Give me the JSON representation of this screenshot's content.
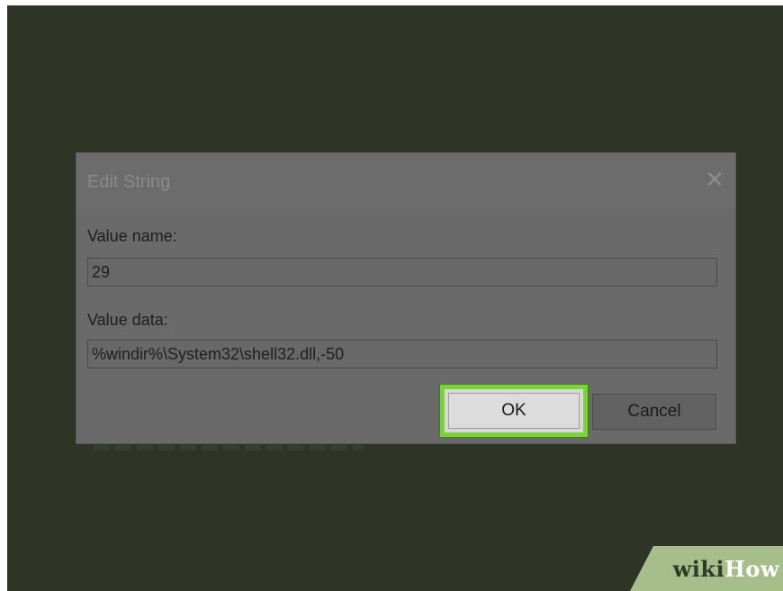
{
  "dialog": {
    "title": "Edit String",
    "close_glyph": "✕",
    "value_name_label": "Value name:",
    "value_name": "29",
    "value_data_label": "Value data:",
    "value_data": "%windir%\\System32\\shell32.dll,-50",
    "ok_label": "OK",
    "cancel_label": "Cancel"
  },
  "watermark": {
    "wiki": "wiki",
    "how": "How"
  },
  "colors": {
    "backdrop": "#2e3526",
    "dialog": "#6a6a6a",
    "highlight": "#7bd33a"
  }
}
